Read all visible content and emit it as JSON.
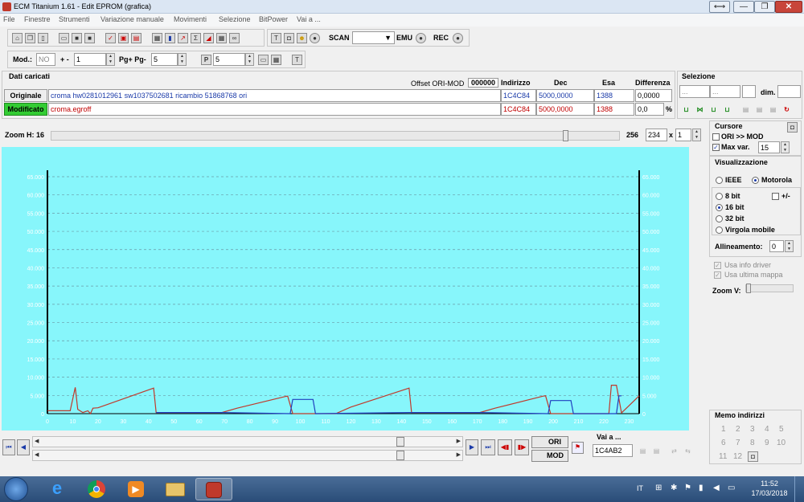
{
  "window": {
    "title": "ECM Titanium 1.61 - Edit EPROM (grafica)",
    "restore_glyph": "⟷",
    "min_glyph": "—",
    "max_glyph": "❐",
    "close_glyph": "✕"
  },
  "menu": [
    "File",
    "Finestre",
    "Strumenti",
    "Variazione manuale",
    "Movimenti",
    "Selezione",
    "BitPower",
    "Vai a ..."
  ],
  "toolbar": {
    "scan": "SCAN",
    "emu": "EMU",
    "rec": "REC"
  },
  "toolbar2": {
    "mod_label": "Mod.:",
    "mod_value": "NO",
    "plusminus": "+ -",
    "step_value": "1",
    "pg_label": "Pg+ Pg-",
    "pg_value": "5",
    "p_value": "5"
  },
  "dati": {
    "title": "Dati caricati",
    "offset_label": "Offset ORI-MOD",
    "offset_value": "000000",
    "col_indirizzo": "Indirizzo",
    "col_dec": "Dec",
    "col_esa": "Esa",
    "col_diff": "Differenza",
    "orig_label": "Originale",
    "orig_file": "croma hw0281012961 sw1037502681 ricambio 51868768 ori",
    "orig_addr": "1C4C84",
    "orig_dec": "5000,0000",
    "orig_esa": "1388",
    "orig_diff": "0,0000",
    "mod_label": "Modificato",
    "mod_file": "croma.egroff",
    "mod_addr": "1C4C84",
    "mod_dec": "5000,0000",
    "mod_esa": "1388",
    "mod_diff": "0,0",
    "percent": "%"
  },
  "selezione": {
    "title": "Selezione",
    "dots1": "...",
    "dots2": "...",
    "dim": "dim."
  },
  "zoom": {
    "label": "Zoom H: 16",
    "value": "256",
    "count": "234",
    "x": "x",
    "mult": "1"
  },
  "cursore": {
    "title": "Cursore",
    "ori_mod": "ORI >> MOD",
    "max_var": "Max var.",
    "max_var_value": "15"
  },
  "vis": {
    "title": "Visualizzazione",
    "ieee": "IEEE",
    "motorola": "Motorola",
    "bit8": "8 bit",
    "pm": "+/-",
    "bit16": "16 bit",
    "bit32": "32 bit",
    "virgola": "Virgola mobile",
    "allineamento": "Allineamento:",
    "allineamento_value": "0",
    "usa_info": "Usa info driver",
    "usa_mappa": "Usa ultima mappa",
    "zoom_v": "Zoom V:"
  },
  "memo": {
    "title": "Memo indirizzi",
    "numbers": [
      "1",
      "2",
      "3",
      "4",
      "5",
      "6",
      "7",
      "8",
      "9",
      "10",
      "11",
      "12"
    ]
  },
  "bottom": {
    "ori": "ORI",
    "mod": "MOD",
    "vai_label": "Vai a ...",
    "vai_value": "1C4AB2"
  },
  "taskbar": {
    "lang": "IT",
    "time": "11:52",
    "date": "17/03/2018"
  },
  "colors": {
    "chart_bg": "#87f6fb",
    "ori_line": "#c0392b",
    "mod_line": "#1f3fbf",
    "modificato_bg": "#33cc33"
  },
  "chart_data": {
    "type": "line",
    "x_ticks": [
      "0",
      "10",
      "20",
      "30",
      "40",
      "50",
      "60",
      "70",
      "80",
      "90",
      "100",
      "110",
      "120",
      "130",
      "140",
      "150",
      "160",
      "170",
      "180",
      "190",
      "200",
      "210",
      "220",
      "230"
    ],
    "y_ticks": [
      "0",
      "5.000",
      "10.000",
      "15.000",
      "20.000",
      "25.000",
      "30.000",
      "35.000",
      "40.000",
      "45.000",
      "50.000",
      "55.000",
      "60.000",
      "65.000"
    ],
    "xlim": [
      0,
      234
    ],
    "ylim": [
      0,
      65000
    ],
    "grid": true,
    "series": [
      {
        "color": "#c0392b",
        "points": [
          [
            0,
            800
          ],
          [
            9,
            800
          ],
          [
            11,
            7200
          ],
          [
            12,
            1200
          ],
          [
            14,
            300
          ],
          [
            16,
            800
          ],
          [
            17,
            0
          ],
          [
            18,
            1500
          ],
          [
            20,
            1600
          ],
          [
            42,
            7000
          ],
          [
            43,
            300
          ],
          [
            69,
            300
          ],
          [
            75,
            1500
          ],
          [
            94,
            4700
          ],
          [
            95,
            4800
          ],
          [
            97,
            0
          ],
          [
            114,
            0
          ],
          [
            120,
            1800
          ],
          [
            143,
            7000
          ],
          [
            144,
            300
          ],
          [
            171,
            300
          ],
          [
            177,
            1500
          ],
          [
            196,
            4800
          ],
          [
            197,
            4900
          ],
          [
            199,
            0
          ],
          [
            222,
            0
          ],
          [
            223,
            7800
          ],
          [
            225,
            7800
          ],
          [
            227,
            200
          ],
          [
            234,
            4900
          ]
        ]
      },
      {
        "color": "#1f3fbf",
        "points": [
          [
            43,
            300
          ],
          [
            69,
            300
          ],
          [
            96,
            0
          ],
          [
            97,
            3900
          ],
          [
            105,
            3900
          ],
          [
            106,
            0
          ],
          [
            144,
            300
          ],
          [
            171,
            300
          ],
          [
            198,
            0
          ],
          [
            199,
            3600
          ],
          [
            207,
            3600
          ],
          [
            208,
            0
          ],
          [
            225,
            0
          ],
          [
            226,
            4900
          ],
          [
            227,
            4900
          ]
        ]
      }
    ]
  }
}
